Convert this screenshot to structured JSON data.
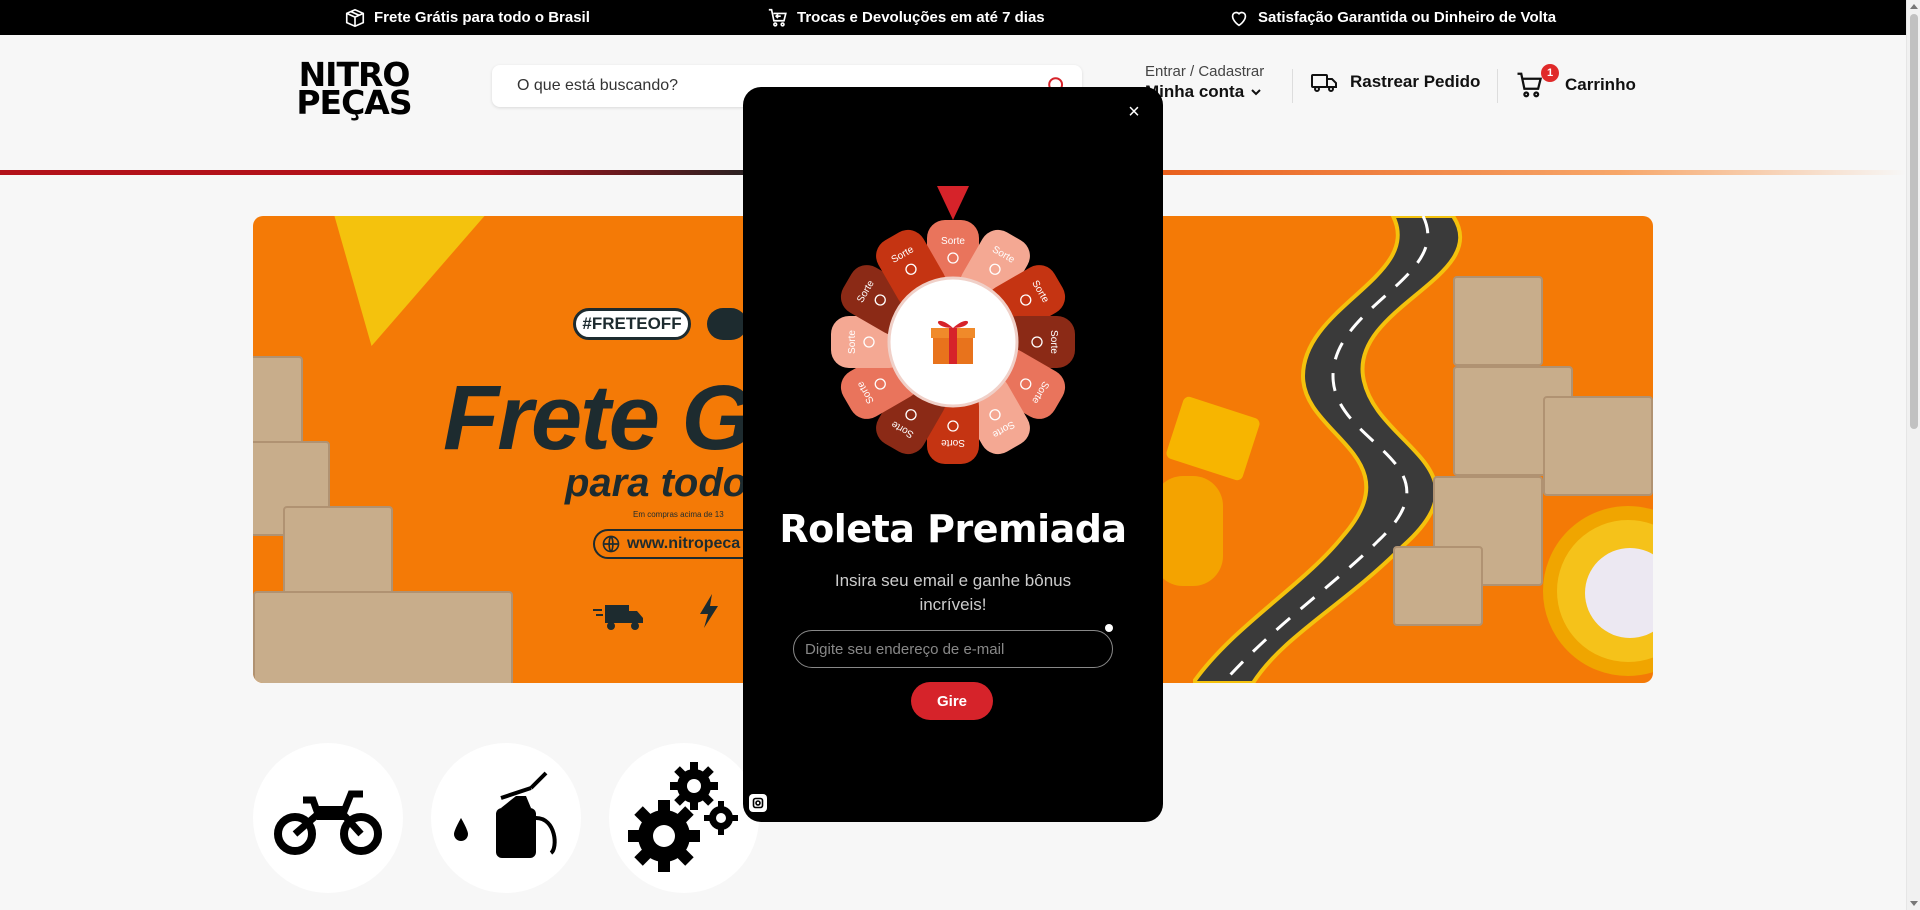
{
  "topbar": {
    "items": [
      {
        "icon": "box-icon",
        "label": "Frete Grátis para todo o Brasil"
      },
      {
        "icon": "cart-return-icon",
        "label": "Trocas e Devoluções em até 7 dias"
      },
      {
        "icon": "heart-icon",
        "label": "Satisfação Garantida ou Dinheiro de Volta"
      }
    ]
  },
  "header": {
    "logo": {
      "line1": "NITRO",
      "line2": "PEÇAS"
    },
    "search": {
      "placeholder": "O que está buscando?"
    },
    "account": {
      "top": "Entrar / Cadastrar",
      "main": "Minha conta"
    },
    "track": {
      "label": "Rastrear Pedido"
    },
    "cart": {
      "label": "Carrinho",
      "count": "1"
    }
  },
  "banner": {
    "tag1": "#FRETEOFF",
    "title": "Frete G",
    "subtitle": "para todo",
    "note": "Em compras acima de 13",
    "url": "www.nitropeca"
  },
  "categories": [
    {
      "icon": "motorcycle-icon"
    },
    {
      "icon": "oil-can-icon"
    },
    {
      "icon": "gears-icon"
    }
  ],
  "modal": {
    "title": "Roleta Premiada",
    "description": "Insira seu email e ganhe bônus incríveis!",
    "email_placeholder": "Digite seu endereço de e-mail",
    "button": "Gire",
    "close": "×",
    "wheel": {
      "segment_label": "Sorte",
      "segments": [
        {
          "color": "#e9745c",
          "icon": "gift-icon"
        },
        {
          "color": "#f4a893",
          "icon": "gift-icon"
        },
        {
          "color": "#c53412",
          "icon": "gift-icon"
        },
        {
          "color": "#8b2a16",
          "icon": "gift-icon"
        },
        {
          "color": "#e9745c",
          "icon": "sad-face-icon"
        },
        {
          "color": "#f4a893",
          "icon": "ticket-icon"
        },
        {
          "color": "#c53412",
          "icon": "sad-face-icon"
        },
        {
          "color": "#8b2a16",
          "icon": "coin-icon"
        },
        {
          "color": "#e9745c",
          "icon": "retry-icon"
        },
        {
          "color": "#f4a893",
          "icon": "ticket-icon"
        },
        {
          "color": "#8b2a16",
          "icon": "retry-icon"
        },
        {
          "color": "#c53412",
          "icon": "gift-icon"
        }
      ],
      "pointer_color": "#d6232a"
    }
  }
}
